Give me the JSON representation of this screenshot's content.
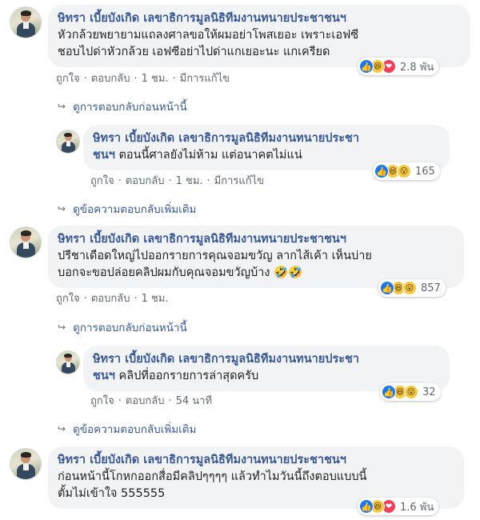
{
  "comments": [
    {
      "name": "ษิทรา เบี้ยบังเกิด เลขาธิการมูลนิธิทีมงานทนายประชาชนฯ",
      "line1": "หัวกล้วยพยายามแถลงศาลขอให้ผมอย่าโพสเยอะ เพราะเอฟซี",
      "line2": "ชอบไปด่าหัวกล้วย เอฟซีอย่าไปด่าแกเยอะนะ แกเครียด",
      "like": "ถูกใจ",
      "reply": "ตอบกลับ",
      "time": "1 ชม.",
      "edited": "มีการแก้ไข",
      "reaction_count": "2.8 พัน",
      "reaction_icons": [
        "like-icon",
        "haha-icon",
        "love-icon"
      ]
    },
    {
      "name_part1": "ษิทรา เบี้ยบังเกิด เลขาธิการมูลนิธิทีมงานทนายประชา",
      "name_part2": "ชนฯ",
      "text": "ตอนนี้ศาลยังไม่ห้าม แต่อนาคตไม่แน่",
      "like": "ถูกใจ",
      "reply": "ตอบกลับ",
      "time": "1 ชม.",
      "edited": "มีการแก้ไข",
      "reaction_count": "165",
      "reaction_icons": [
        "like-icon",
        "haha-icon",
        "wow-icon"
      ]
    },
    {
      "name": "ษิทรา เบี้ยบังเกิด เลขาธิการมูลนิธิทีมงานทนายประชาชนฯ",
      "line1": "ปรีชาเดือดใหญ่ไปออกรายการคุณจอมขวัญ ลากไส้เค้า เห็นบ่าย",
      "line2": "บอกจะขอปล่อยคลิปผมกับคุณจอมขวัญบ้าง 🤣🤣",
      "like": "ถูกใจ",
      "reply": "ตอบกลับ",
      "time": "1 ชม.",
      "reaction_count": "857",
      "reaction_icons": [
        "like-icon",
        "haha-icon",
        "wow-icon"
      ]
    },
    {
      "name_part1": "ษิทรา เบี้ยบังเกิด เลขาธิการมูลนิธิทีมงานทนายประชา",
      "name_part2": "ชนฯ",
      "text": "คลิปที่ออกรายการล่าสุดครับ",
      "like": "ถูกใจ",
      "reply": "ตอบกลับ",
      "time": "54 นาที",
      "reaction_count": "32",
      "reaction_icons": [
        "like-icon",
        "haha-icon",
        "wow-icon"
      ]
    },
    {
      "name": "ษิทรา เบี้ยบังเกิด เลขาธิการมูลนิธิทีมงานทนายประชาชนฯ",
      "line1": "ก่อนหน้านี้โกหกออกสื่อมีคลิปๆๆๆๆ แล้วทำไมวันนี้ถึงตอบแบบนี้",
      "line2": "ตั้มไม่เข้าใจ 555555",
      "reaction_count": "1.6 พัน",
      "reaction_icons": [
        "like-icon",
        "haha-icon",
        "love-icon"
      ]
    }
  ],
  "links": {
    "prev_replies_1": "ดูการตอบกลับก่อนหน้านี้",
    "more_replies_1": "ดูข้อความตอบกลับเพิ่มเติม",
    "prev_replies_2": "ดูการตอบกลับก่อนหน้านี้",
    "more_replies_2": "ดูข้อความตอบกลับเพิ่มเติม"
  },
  "glyphs": {
    "like": "👍",
    "haha": "😆",
    "wow": "😮",
    "love": "❤",
    "dot": "·",
    "arrow": "↪"
  },
  "colors": {
    "name_link": "#385898",
    "bubble_bg": "#f2f3f5",
    "meta_text": "#606770"
  }
}
